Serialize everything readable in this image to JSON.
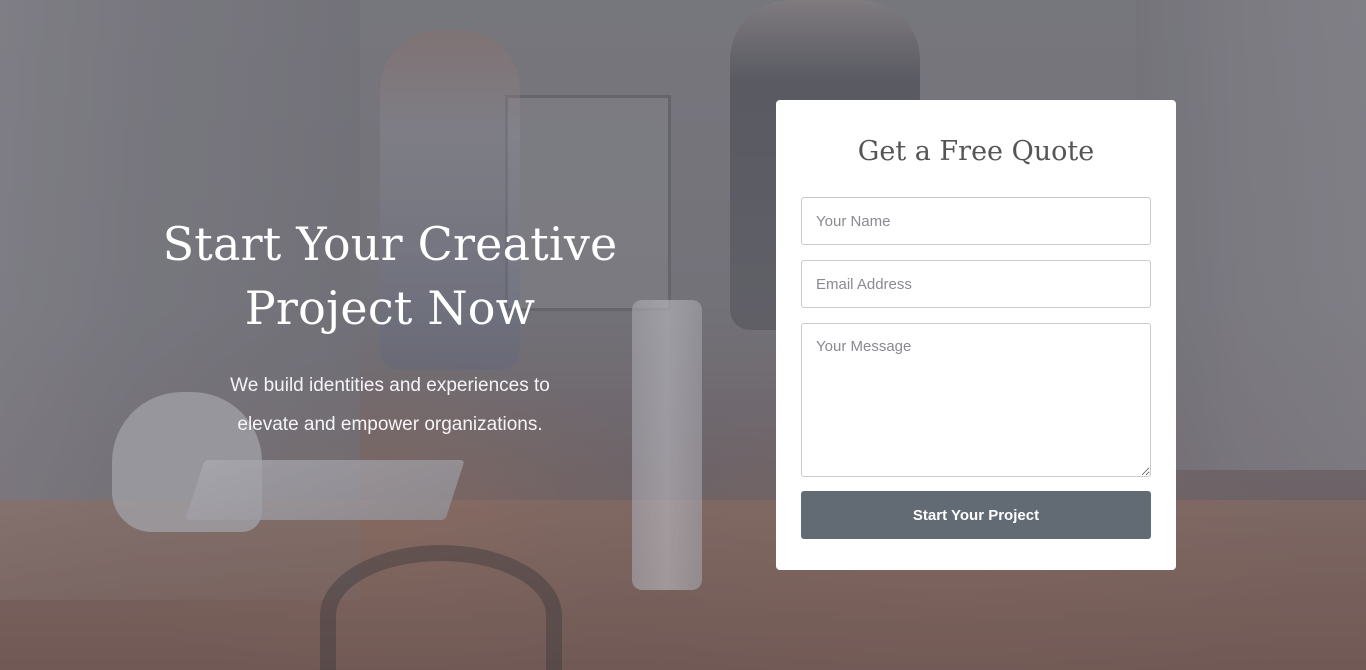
{
  "hero": {
    "title_line1": "Start Your Creative",
    "title_line2": "Project Now",
    "subtitle_line1": "We build identities and experiences to",
    "subtitle_line2": "elevate and empower organizations."
  },
  "quote_form": {
    "title": "Get a Free Quote",
    "name_placeholder": "Your Name",
    "email_placeholder": "Email Address",
    "message_placeholder": "Your Message",
    "submit_label": "Start Your Project"
  },
  "colors": {
    "button_bg": "#626a74",
    "card_bg": "#ffffff",
    "hero_text": "#ffffff"
  }
}
